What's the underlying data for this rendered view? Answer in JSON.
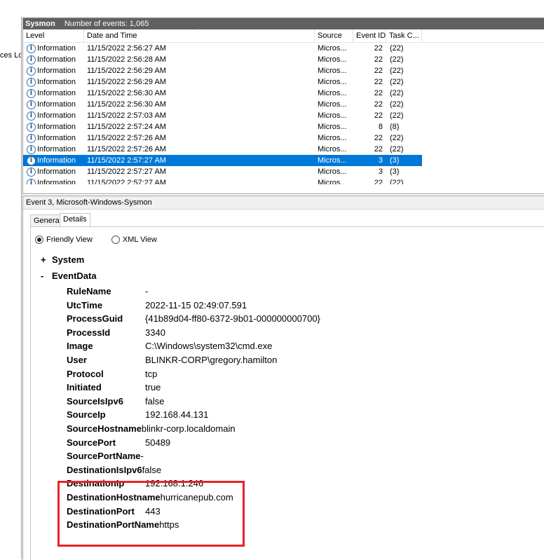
{
  "left_pane": {
    "fragment": "ces Lo"
  },
  "log": {
    "title": "Sysmon",
    "event_count": "Number of events: 1,065",
    "columns": [
      "Level",
      "Date and Time",
      "Source",
      "Event ID",
      "Task C..."
    ],
    "rows": [
      {
        "level": "Information",
        "date": "11/15/2022 2:56:27 AM",
        "source": "Micros...",
        "event_id": "22",
        "task": "(22)"
      },
      {
        "level": "Information",
        "date": "11/15/2022 2:56:28 AM",
        "source": "Micros...",
        "event_id": "22",
        "task": "(22)"
      },
      {
        "level": "Information",
        "date": "11/15/2022 2:56:29 AM",
        "source": "Micros...",
        "event_id": "22",
        "task": "(22)"
      },
      {
        "level": "Information",
        "date": "11/15/2022 2:56:29 AM",
        "source": "Micros...",
        "event_id": "22",
        "task": "(22)"
      },
      {
        "level": "Information",
        "date": "11/15/2022 2:56:30 AM",
        "source": "Micros...",
        "event_id": "22",
        "task": "(22)"
      },
      {
        "level": "Information",
        "date": "11/15/2022 2:56:30 AM",
        "source": "Micros...",
        "event_id": "22",
        "task": "(22)"
      },
      {
        "level": "Information",
        "date": "11/15/2022 2:57:03 AM",
        "source": "Micros...",
        "event_id": "22",
        "task": "(22)"
      },
      {
        "level": "Information",
        "date": "11/15/2022 2:57:24 AM",
        "source": "Micros...",
        "event_id": "8",
        "task": "(8)"
      },
      {
        "level": "Information",
        "date": "11/15/2022 2:57:26 AM",
        "source": "Micros...",
        "event_id": "22",
        "task": "(22)"
      },
      {
        "level": "Information",
        "date": "11/15/2022 2:57:26 AM",
        "source": "Micros...",
        "event_id": "22",
        "task": "(22)"
      },
      {
        "level": "Information",
        "date": "11/15/2022 2:57:27 AM",
        "source": "Micros...",
        "event_id": "3",
        "task": "(3)",
        "selected": true
      },
      {
        "level": "Information",
        "date": "11/15/2022 2:57:27 AM",
        "source": "Micros...",
        "event_id": "3",
        "task": "(3)"
      },
      {
        "level": "Information",
        "date": "11/15/2022 2:57:27 AM",
        "source": "Micros...",
        "event_id": "22",
        "task": "(22)",
        "partial": true
      }
    ]
  },
  "details": {
    "header": "Event 3, Microsoft-Windows-Sysmon",
    "tabs": [
      "General",
      "Details"
    ],
    "view_options": [
      "Friendly View",
      "XML View"
    ],
    "tree": {
      "system_node": "System",
      "eventdata_node": "EventData",
      "expand_symbol": "+",
      "collapse_symbol": "-"
    },
    "fields": [
      {
        "key": "RuleName",
        "value": "-"
      },
      {
        "key": "UtcTime",
        "value": "2022-11-15 02:49:07.591"
      },
      {
        "key": "ProcessGuid",
        "value": "{41b89d04-ff80-6372-9b01-000000000700}"
      },
      {
        "key": "ProcessId",
        "value": "3340"
      },
      {
        "key": "Image",
        "value": "C:\\Windows\\system32\\cmd.exe"
      },
      {
        "key": "User",
        "value": "BLINKR-CORP\\gregory.hamilton"
      },
      {
        "key": "Protocol",
        "value": "tcp"
      },
      {
        "key": "Initiated",
        "value": "true"
      },
      {
        "key": "SourceIsIpv6",
        "value": "false"
      },
      {
        "key": "SourceIp",
        "value": "192.168.44.131"
      },
      {
        "key": "SourceHostname",
        "value": "blinkr-corp.localdomain",
        "tight": true
      },
      {
        "key": "SourcePort",
        "value": "50489"
      },
      {
        "key": "SourcePortName",
        "value": "-",
        "tight": true
      },
      {
        "key": "DestinationIsIpv6",
        "value": "false",
        "tight": true
      },
      {
        "key": "DestinationIp",
        "value": "192.168.1.246"
      },
      {
        "key": "DestinationHostname",
        "value": "hurricanepub.com",
        "tight": true
      },
      {
        "key": "DestinationPort",
        "value": "443"
      },
      {
        "key": "DestinationPortName",
        "value": "https",
        "tight": true
      }
    ]
  },
  "colors": {
    "selection": "#0078d7",
    "highlight_box": "#e8232a",
    "title_bar": "#5f6062"
  }
}
